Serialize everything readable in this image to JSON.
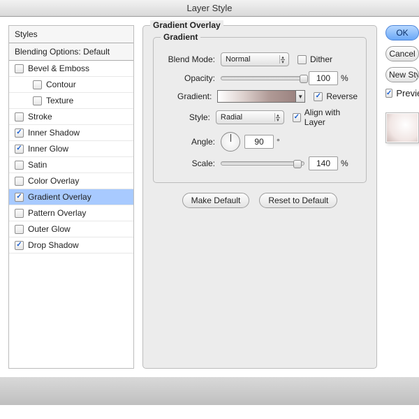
{
  "window": {
    "title": "Layer Style"
  },
  "sidebar": {
    "header": "Styles",
    "subheader": "Blending Options: Default",
    "items": [
      {
        "label": "Bevel & Emboss",
        "checked": false
      },
      {
        "label": "Contour",
        "checked": false,
        "child": true
      },
      {
        "label": "Texture",
        "checked": false,
        "child": true
      },
      {
        "label": "Stroke",
        "checked": false
      },
      {
        "label": "Inner Shadow",
        "checked": true
      },
      {
        "label": "Inner Glow",
        "checked": true
      },
      {
        "label": "Satin",
        "checked": false
      },
      {
        "label": "Color Overlay",
        "checked": false
      },
      {
        "label": "Gradient Overlay",
        "checked": true,
        "selected": true
      },
      {
        "label": "Pattern Overlay",
        "checked": false
      },
      {
        "label": "Outer Glow",
        "checked": false
      },
      {
        "label": "Drop Shadow",
        "checked": true
      }
    ]
  },
  "panel": {
    "group_title": "Gradient Overlay",
    "inner_title": "Gradient",
    "labels": {
      "blend_mode": "Blend Mode:",
      "opacity": "Opacity:",
      "gradient": "Gradient:",
      "style": "Style:",
      "angle": "Angle:",
      "scale": "Scale:"
    },
    "blend_mode_value": "Normal",
    "dither": {
      "label": "Dither",
      "checked": false
    },
    "opacity": {
      "value": "100",
      "unit": "%"
    },
    "reverse": {
      "label": "Reverse",
      "checked": true
    },
    "style_value": "Radial",
    "align": {
      "label": "Align with Layer",
      "checked": true
    },
    "angle": {
      "value": "90",
      "unit": "°"
    },
    "scale": {
      "value": "140",
      "unit": "%"
    },
    "make_default": "Make Default",
    "reset_default": "Reset to Default"
  },
  "right": {
    "ok": "OK",
    "cancel": "Cancel",
    "new_style": "New Style...",
    "preview": {
      "label": "Preview",
      "checked": true
    }
  }
}
